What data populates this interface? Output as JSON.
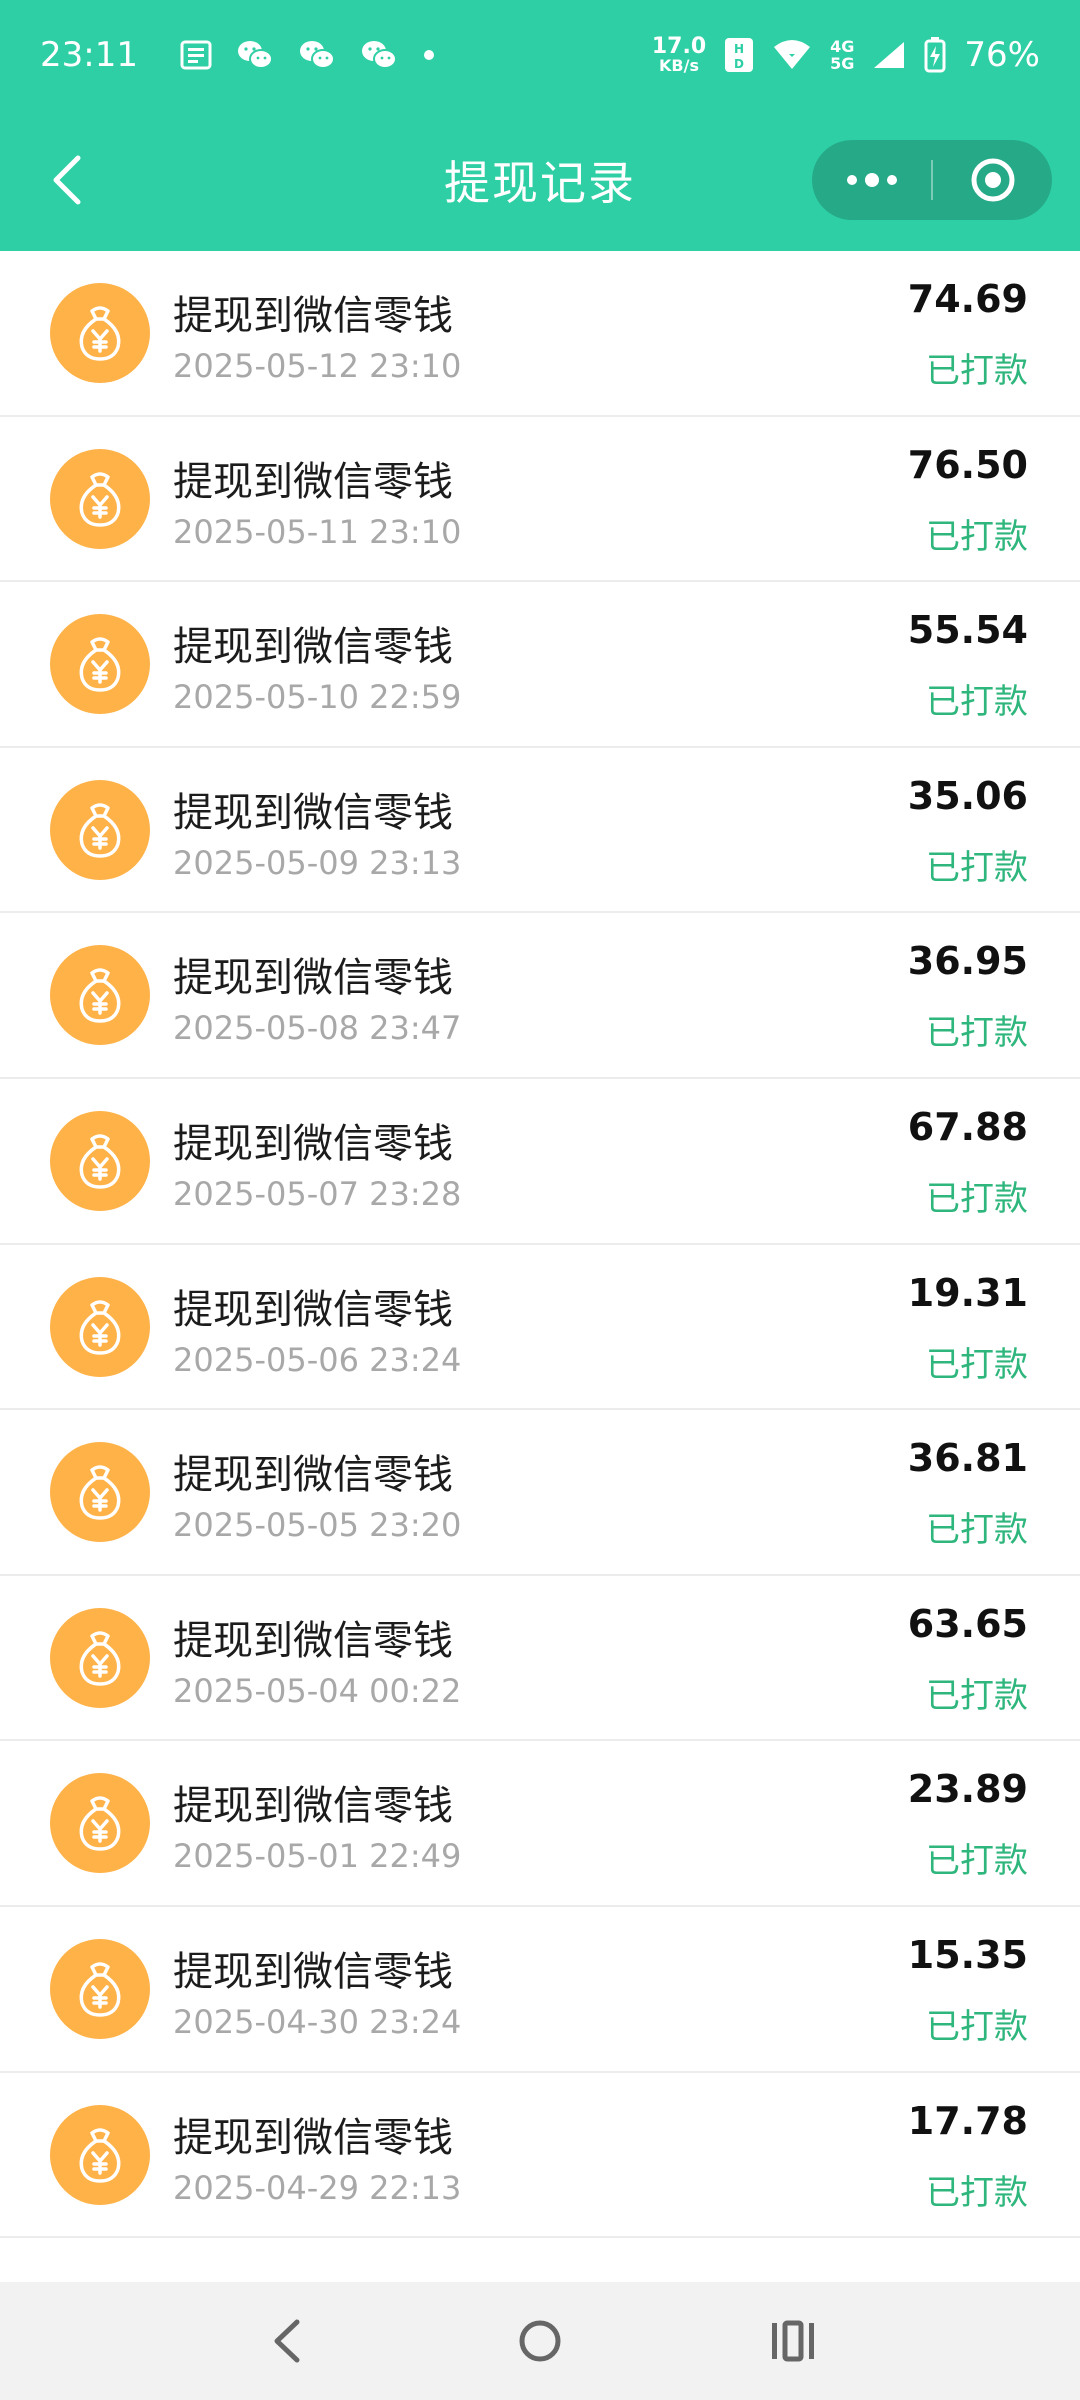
{
  "status_bar": {
    "time": "23:11",
    "net_speed_value": "17.0",
    "net_speed_unit": "KB/s",
    "hd1": "HD",
    "signal_4g": "4G",
    "signal_5g": "5G",
    "battery": "76%"
  },
  "nav": {
    "title": "提现记录"
  },
  "records": [
    {
      "title": "提现到微信零钱",
      "date": "2025-05-12 23:10",
      "amount": "74.69",
      "status": "已打款"
    },
    {
      "title": "提现到微信零钱",
      "date": "2025-05-11 23:10",
      "amount": "76.50",
      "status": "已打款"
    },
    {
      "title": "提现到微信零钱",
      "date": "2025-05-10 22:59",
      "amount": "55.54",
      "status": "已打款"
    },
    {
      "title": "提现到微信零钱",
      "date": "2025-05-09 23:13",
      "amount": "35.06",
      "status": "已打款"
    },
    {
      "title": "提现到微信零钱",
      "date": "2025-05-08 23:47",
      "amount": "36.95",
      "status": "已打款"
    },
    {
      "title": "提现到微信零钱",
      "date": "2025-05-07 23:28",
      "amount": "67.88",
      "status": "已打款"
    },
    {
      "title": "提现到微信零钱",
      "date": "2025-05-06 23:24",
      "amount": "19.31",
      "status": "已打款"
    },
    {
      "title": "提现到微信零钱",
      "date": "2025-05-05 23:20",
      "amount": "36.81",
      "status": "已打款"
    },
    {
      "title": "提现到微信零钱",
      "date": "2025-05-04 00:22",
      "amount": "63.65",
      "status": "已打款"
    },
    {
      "title": "提现到微信零钱",
      "date": "2025-05-01 22:49",
      "amount": "23.89",
      "status": "已打款"
    },
    {
      "title": "提现到微信零钱",
      "date": "2025-04-30 23:24",
      "amount": "15.35",
      "status": "已打款"
    },
    {
      "title": "提现到微信零钱",
      "date": "2025-04-29 22:13",
      "amount": "17.78",
      "status": "已打款"
    }
  ],
  "colors": {
    "header_bg": "#2ecfa5",
    "icon_bg": "#ffb248",
    "status_green": "#2eb67d"
  }
}
